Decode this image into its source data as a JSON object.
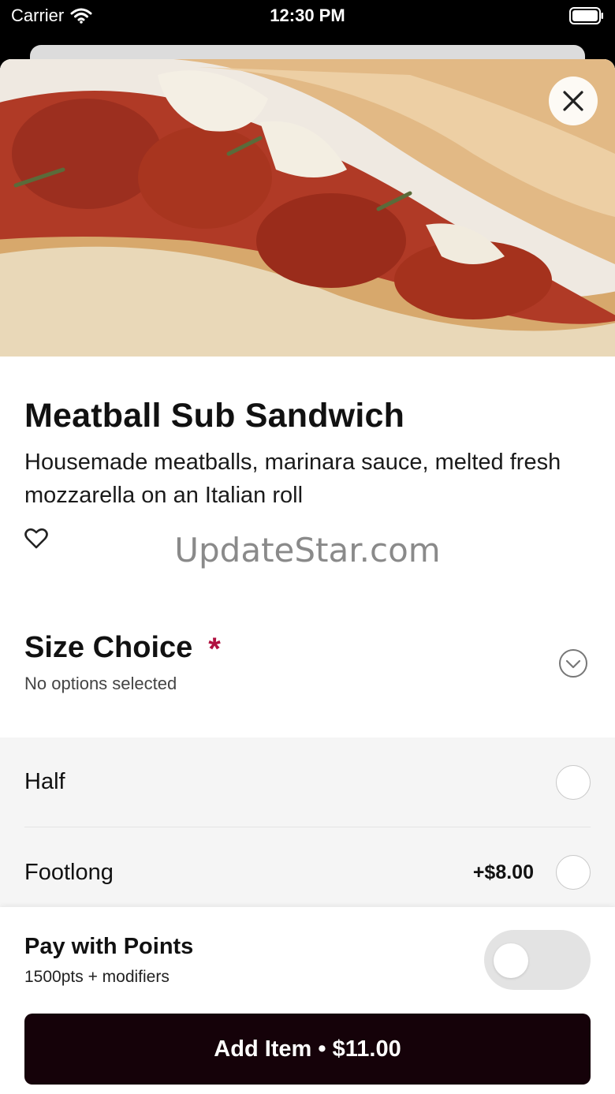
{
  "status_bar": {
    "carrier": "Carrier",
    "time": "12:30 PM"
  },
  "item": {
    "title": "Meatball Sub Sandwich",
    "description": "Housemade meatballs, marinara sauce, melted fresh mozzarella on an Italian roll",
    "watermark": "UpdateStar.com"
  },
  "size_choice": {
    "title": "Size Choice",
    "required_mark": "*",
    "subtitle": "No options selected",
    "options": [
      {
        "label": "Half",
        "price": ""
      },
      {
        "label": "Footlong",
        "price": "+$8.00"
      }
    ]
  },
  "footer": {
    "pay_title": "Pay with Points",
    "pay_subtitle": "1500pts + modifiers",
    "pay_toggle_on": false,
    "add_button": "Add Item • $11.00"
  },
  "colors": {
    "accent_required": "#b0103f",
    "button_bg": "#150209"
  },
  "icons": [
    "wifi-icon",
    "battery-icon",
    "close-icon",
    "heart-icon",
    "chevron-down-icon"
  ]
}
